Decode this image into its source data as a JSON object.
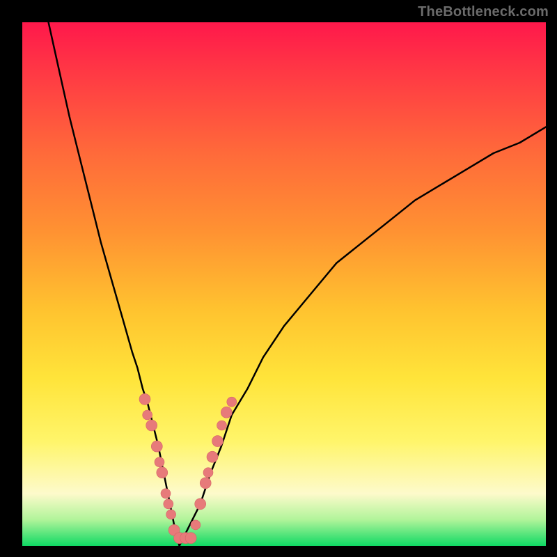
{
  "watermark": "TheBottleneck.com",
  "colors": {
    "gradient_top": "#ff184b",
    "gradient_mid1": "#ff9232",
    "gradient_mid2": "#ffe43a",
    "gradient_bottom": "#0fd964",
    "curve": "#000000",
    "dot": "#e77a7a",
    "frame": "#000000"
  },
  "chart_data": {
    "type": "line",
    "title": "",
    "xlabel": "",
    "ylabel": "",
    "xlim": [
      0,
      100
    ],
    "ylim": [
      0,
      100
    ],
    "series": [
      {
        "name": "left-curve",
        "x": [
          5,
          7,
          9,
          11,
          13,
          15,
          17,
          19,
          21,
          22,
          23,
          24,
          25,
          26,
          27,
          28,
          29,
          30
        ],
        "y": [
          100,
          91,
          82,
          74,
          66,
          58,
          51,
          44,
          37,
          34,
          30,
          27,
          23,
          19,
          14,
          9,
          4,
          0
        ]
      },
      {
        "name": "right-curve",
        "x": [
          30,
          32,
          34,
          36,
          38,
          40,
          43,
          46,
          50,
          55,
          60,
          65,
          70,
          75,
          80,
          85,
          90,
          95,
          100
        ],
        "y": [
          0,
          4,
          8,
          14,
          19,
          25,
          30,
          36,
          42,
          48,
          54,
          58,
          62,
          66,
          69,
          72,
          75,
          77,
          80
        ]
      }
    ],
    "markers": [
      {
        "series": "left-curve",
        "x": 23.4,
        "y": 28,
        "r": 8
      },
      {
        "series": "left-curve",
        "x": 23.9,
        "y": 25,
        "r": 7
      },
      {
        "series": "left-curve",
        "x": 24.7,
        "y": 23,
        "r": 8
      },
      {
        "series": "left-curve",
        "x": 25.7,
        "y": 19,
        "r": 8
      },
      {
        "series": "left-curve",
        "x": 26.2,
        "y": 16,
        "r": 7
      },
      {
        "series": "left-curve",
        "x": 26.7,
        "y": 14,
        "r": 8
      },
      {
        "series": "left-curve",
        "x": 27.4,
        "y": 10,
        "r": 7
      },
      {
        "series": "left-curve",
        "x": 27.9,
        "y": 8,
        "r": 7
      },
      {
        "series": "left-curve",
        "x": 28.4,
        "y": 6,
        "r": 7
      },
      {
        "series": "left-curve",
        "x": 29.0,
        "y": 3,
        "r": 8
      },
      {
        "series": "trough",
        "x": 30.0,
        "y": 1.5,
        "r": 8
      },
      {
        "series": "trough",
        "x": 31.2,
        "y": 1.5,
        "r": 8
      },
      {
        "series": "trough",
        "x": 32.2,
        "y": 1.5,
        "r": 8
      },
      {
        "series": "right-curve",
        "x": 33.1,
        "y": 4,
        "r": 7
      },
      {
        "series": "right-curve",
        "x": 34.0,
        "y": 8,
        "r": 8
      },
      {
        "series": "right-curve",
        "x": 35.0,
        "y": 12,
        "r": 8
      },
      {
        "series": "right-curve",
        "x": 35.5,
        "y": 14,
        "r": 7
      },
      {
        "series": "right-curve",
        "x": 36.3,
        "y": 17,
        "r": 8
      },
      {
        "series": "right-curve",
        "x": 37.3,
        "y": 20,
        "r": 8
      },
      {
        "series": "right-curve",
        "x": 38.1,
        "y": 23,
        "r": 7
      },
      {
        "series": "right-curve",
        "x": 39.0,
        "y": 25.5,
        "r": 8
      },
      {
        "series": "right-curve",
        "x": 40.0,
        "y": 27.5,
        "r": 7
      }
    ],
    "legend": false,
    "grid": false
  }
}
